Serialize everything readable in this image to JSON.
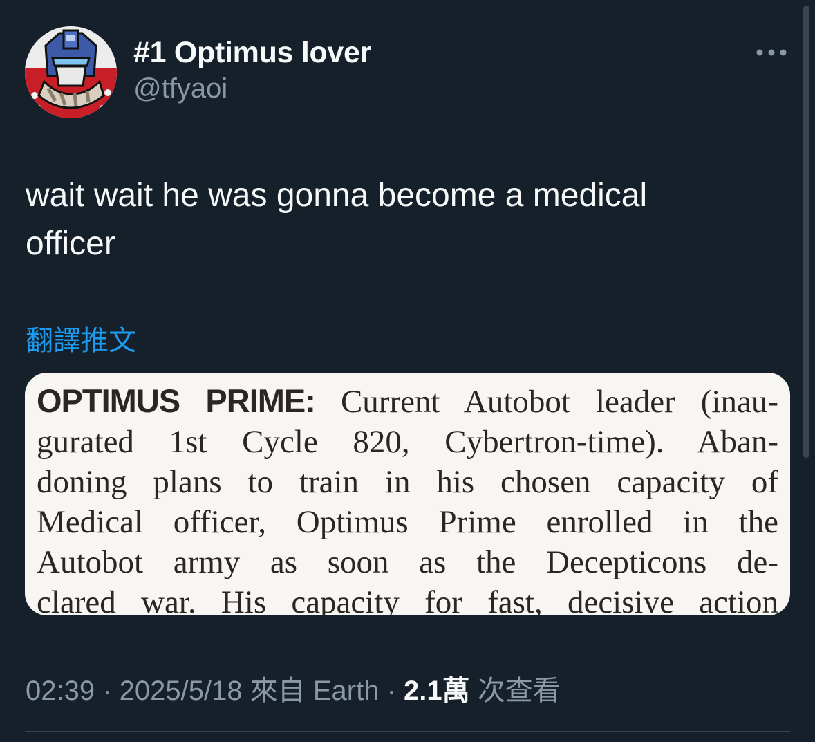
{
  "author": {
    "display_name": "#1 Optimus lover",
    "handle": "@tfyaoi"
  },
  "tweet": {
    "text": "wait wait he was gonna become a medical\nofficer",
    "translate_label": "翻譯推文"
  },
  "media": {
    "lead": "OPTIMUS PRIME:",
    "lines": [
      " Current Autobot leader (inau-",
      "gurated 1st Cycle 820, Cybertron-time). Aban-",
      "doning plans to train in his chosen capacity of",
      "Medical officer, Optimus Prime enrolled in the",
      "Autobot army as soon as the Decepticons de-",
      "clared war. His capacity for fast, decisive action"
    ]
  },
  "meta": {
    "time": "02:39",
    "separator": " · ",
    "date": "2025/5/18",
    "source": " 來自 Earth",
    "views_count": "2.1萬",
    "views_label": " 次查看"
  },
  "colors": {
    "background": "#15202b",
    "text_primary": "#f7f9f9",
    "text_secondary": "#8b98a5",
    "accent": "#1d9bf0",
    "divider": "#38444d"
  },
  "icons": {
    "more": "more-horizontal-icon"
  }
}
